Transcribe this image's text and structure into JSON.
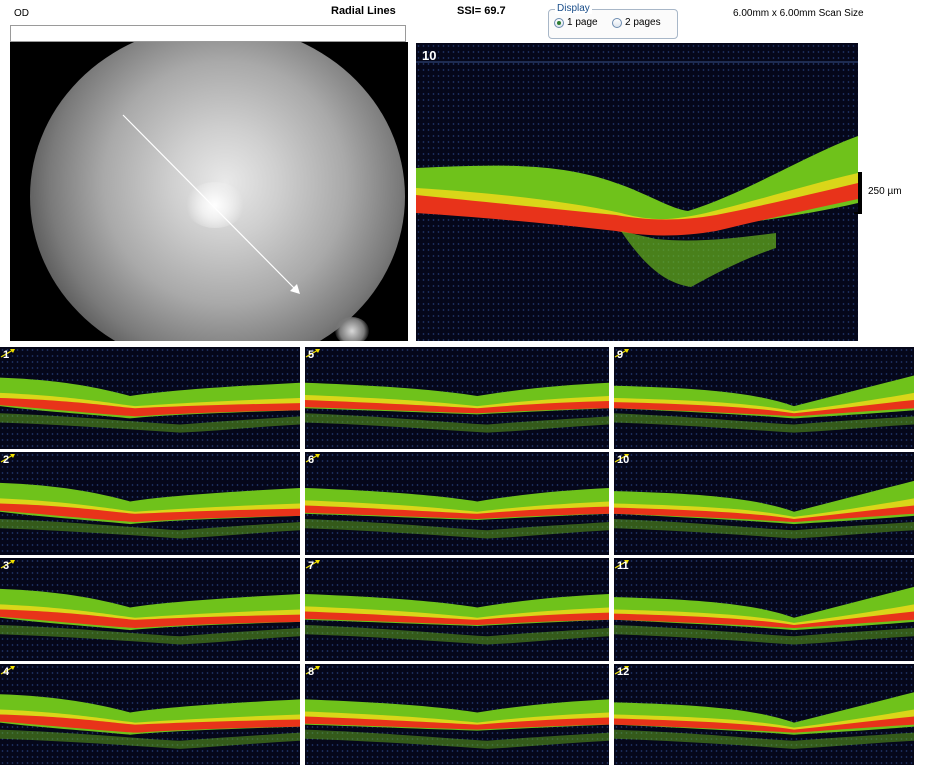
{
  "header": {
    "eye": "OD",
    "scan_mode": "Radial Lines",
    "ssi": "SSI= 69.7",
    "scan_size": "6.00mm x 6.00mm Scan Size"
  },
  "display": {
    "legend": "Display",
    "options": [
      {
        "label": "1 page",
        "selected": true
      },
      {
        "label": "2 pages",
        "selected": false
      }
    ]
  },
  "main_scan": {
    "number": "10"
  },
  "scale": {
    "label": "250 µm"
  },
  "thumbnails": [
    "1",
    "5",
    "9",
    "2",
    "6",
    "10",
    "3",
    "7",
    "11",
    "4",
    "8",
    "12"
  ],
  "colors": {
    "background": "#05071a",
    "retina_green": "#6fc21b",
    "retina_yellow": "#e6d81a",
    "retina_red": "#e8331a",
    "orient_arrow": "#f0e000"
  }
}
